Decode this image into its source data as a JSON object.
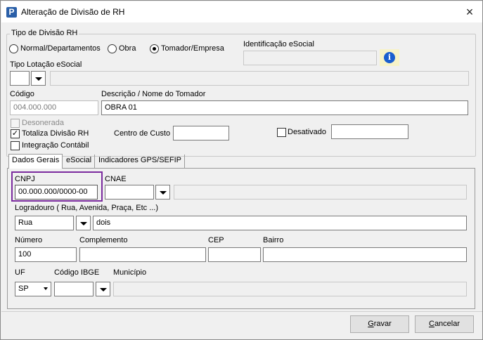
{
  "window": {
    "title": "Alteração de Divisão de RH",
    "close": "×",
    "app_icon_letter": "P"
  },
  "tipo_divisao": {
    "group_label": "Tipo de Divisão RH",
    "options": [
      "Normal/Departamentos",
      "Obra",
      "Tomador/Empresa"
    ],
    "selected": "Tomador/Empresa"
  },
  "identificacao_esocial": {
    "label": "Identificação eSocial",
    "value": ""
  },
  "tipo_lotacao": {
    "label": "Tipo Lotação eSocial",
    "value": "",
    "description": ""
  },
  "codigo": {
    "label": "Código",
    "value": "004.000.000"
  },
  "descricao": {
    "label": "Descrição / Nome do Tomador",
    "value": "OBRA 01"
  },
  "desonerada": {
    "label": "Desonerada",
    "checked": false,
    "disabled": true
  },
  "totaliza": {
    "label": "Totaliza Divisão RH",
    "checked": true,
    "mark": "✓"
  },
  "integracao": {
    "label": "Integração Contábil",
    "checked": false
  },
  "centro_custo": {
    "label": "Centro de Custo",
    "value": ""
  },
  "desativado": {
    "label": "Desativado",
    "checked": false,
    "value": ""
  },
  "tabs": [
    "Dados Gerais",
    "eSocial",
    "Indicadores GPS/SEFIP"
  ],
  "active_tab": "Dados Gerais",
  "form": {
    "cnpj": {
      "label": "CNPJ",
      "value": "00.000.000/0000-00"
    },
    "cnae": {
      "label": "CNAE",
      "value": "",
      "description": ""
    },
    "logradouro": {
      "label": "Logradouro ( Rua, Avenida, Praça, Etc ...)",
      "tipo": "Rua",
      "nome": "dois"
    },
    "numero": {
      "label": "Número",
      "value": "100"
    },
    "complemento": {
      "label": "Complemento",
      "value": ""
    },
    "cep": {
      "label": "CEP",
      "value": ""
    },
    "bairro": {
      "label": "Bairro",
      "value": ""
    },
    "uf": {
      "label": "UF",
      "value": "SP"
    },
    "codigo_ibge": {
      "label": "Código IBGE",
      "value": ""
    },
    "municipio": {
      "label": "Município",
      "value": ""
    }
  },
  "buttons": {
    "gravar": {
      "accel": "G",
      "rest": "ravar"
    },
    "cancelar": {
      "accel": "C",
      "rest": "ancelar"
    }
  },
  "colors": {
    "highlight_border": "#7b2b9e",
    "info_icon": "#1a5fcf",
    "info_icon_bg": "#f7f3c8",
    "app_icon": "#2a5fa8"
  },
  "icons": {
    "close": "close-icon",
    "info": "info-icon",
    "app": "app-icon",
    "dropdown": "chevron-down-icon"
  }
}
